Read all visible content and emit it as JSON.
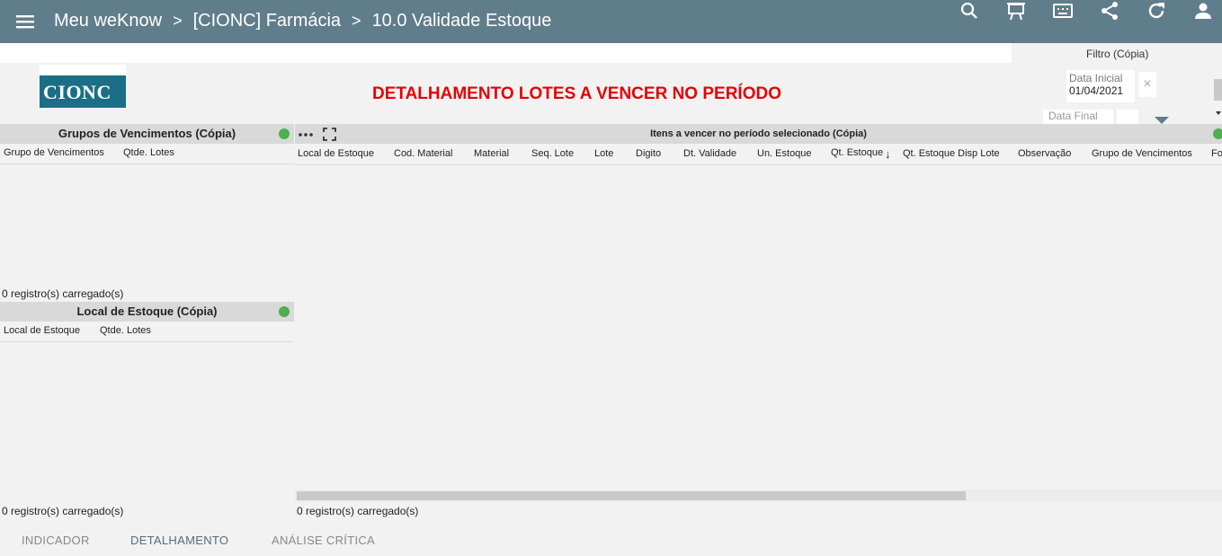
{
  "header": {
    "crumbs": [
      "Meu weKnow",
      "[CIONC] Farmácia",
      "10.0 Validade Estoque"
    ],
    "separator": ">",
    "icons": [
      "search-icon",
      "presentation-icon",
      "keyboard-icon",
      "share-icon",
      "refresh-icon",
      "account-icon"
    ]
  },
  "logo": {
    "text": "CIONC"
  },
  "title": "DETALHAMENTO LOTES A VENCER NO PERÍODO",
  "filter": {
    "title": "Filtro (Cópia)",
    "data_inicial_label": "Data Inicial",
    "data_inicial_value": "01/04/2021",
    "clear": "×",
    "data_final_label": "Data Final"
  },
  "grupos": {
    "title": "Grupos de Vencimentos (Cópia)",
    "columns": [
      "Grupo de Vencimentos",
      "Qtde. Lotes"
    ],
    "status": "0 registro(s) carregado(s)"
  },
  "local": {
    "title": "Local de Estoque (Cópia)",
    "columns": [
      "Local de Estoque",
      "Qtde. Lotes"
    ],
    "status": "0 registro(s) carregado(s)"
  },
  "itens": {
    "title": "Itens a vencer no período selecionado (Cópia)",
    "columns": [
      "Local de Estoque",
      "Cod. Material",
      "Material",
      "Seq. Lote",
      "Lote",
      "Digito",
      "Dt. Validade",
      "Un. Estoque",
      "Qt. Estoque",
      "Qt. Estoque Disp Lote",
      "Observação",
      "Grupo de Vencimentos",
      "Fo"
    ],
    "sort_indicator": "↓",
    "status": "0 registro(s) carregado(s)"
  },
  "tabs": [
    "INDICADOR",
    "DETALHAMENTO",
    "ANÁLISE CRÍTICA"
  ],
  "colors": {
    "header": "#607d8b",
    "title": "#e60000",
    "status_dot": "#4caf50",
    "logo": "#1a6f86"
  }
}
